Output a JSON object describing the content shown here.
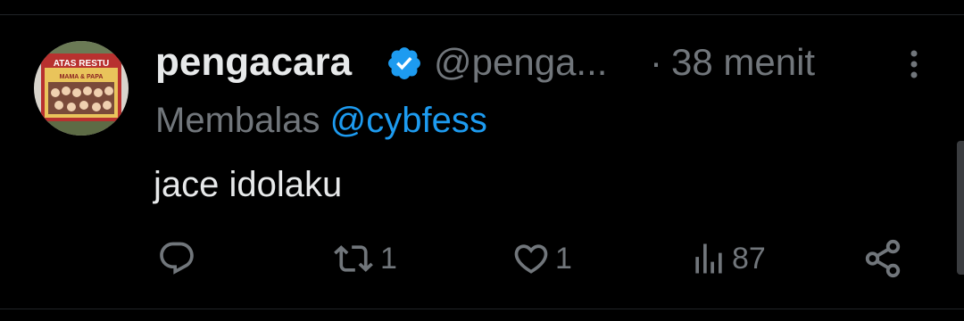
{
  "tweet": {
    "display_name": "pengacara",
    "handle": "@penga...",
    "separator": "·",
    "time": "38 menit",
    "replying_prefix": "Membalas",
    "replying_to": "@cybfess",
    "text": "jace idolaku",
    "avatar_text_top": "ATAS RESTU",
    "avatar_text_sub": "MAMA & PAPA"
  },
  "actions": {
    "reply_icon": "reply-icon",
    "retweet_icon": "retweet-icon",
    "retweet_count": "1",
    "like_icon": "heart-icon",
    "like_count": "1",
    "views_icon": "views-icon",
    "views_count": "87",
    "share_icon": "share-icon"
  },
  "colors": {
    "background": "#000000",
    "primary_text": "#e7e9ea",
    "secondary_text": "#71767b",
    "link": "#1d9bf0",
    "verified": "#1d9bf0"
  }
}
